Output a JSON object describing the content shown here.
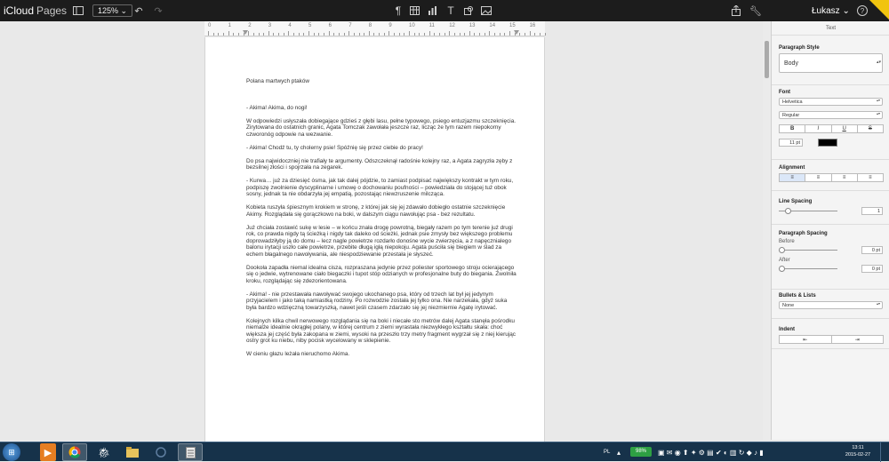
{
  "app": {
    "brand": "iCloud",
    "product": "Pages",
    "zoom": "125%",
    "user": "Łukasz ⌄"
  },
  "toolbar": {
    "left_icons": [
      "sidebar-icon",
      "undo-icon",
      "redo-icon"
    ],
    "center_icons": [
      "paragraph-icon",
      "table-icon",
      "chart-icon",
      "textbox-icon",
      "shape-icon",
      "image-icon"
    ],
    "right_icons": [
      "share-icon",
      "wrench-icon",
      "help-icon"
    ]
  },
  "ruler": {
    "labels": [
      "0",
      "1",
      "2",
      "3",
      "4",
      "5",
      "6",
      "7",
      "8",
      "9",
      "10",
      "11",
      "12",
      "13",
      "14",
      "15",
      "16"
    ]
  },
  "document": {
    "title": "Polana martwych ptaków",
    "paragraphs": [
      "- Akima! Akima, do nogi!",
      "W odpowiedzi usłyszała dobiegające gdzieś z głębi lasu, pełne typowego, psiego entuzjazmu szczeknięcia. Zirytowana do ostatnich granic, Agata Tomczak zawołała jeszcze raz, licząc że tym razem niepokorny czworonóg odpowie na wezwanie.",
      "- Akima! Chodź tu, ty cholerny psie! Spóźnię się przez ciebie do pracy!",
      "Do psa najwidoczniej nie trafiały te argumenty. Odszczeknął radośnie kolejny raz, a Agata zagryzła zęby z bezsilnej złości i spojrzała na zegarek.",
      "- Kurwa… już za dziesięć ósma, jak tak dalej pójdzie, to zamiast podpisać największy kontrakt w tym roku, podpiszę zwolnienie dyscyplinarne i umowę o dochowaniu poufności – powiedziała do stojącej tuż obok sosny, jednak ta nie obdarzyła jej empatią, pozostając niewzruszenie milcząca.",
      "Kobieta ruszyła śpiesznym krokiem w stronę, z której jak się jej zdawało dobiegło ostatnie szczeknięcie Akimy. Rozglądała się gorączkowo na boki, w dalszym ciągu nawołując psa - bez rezultatu.",
      "Już chciała zostawić sukę w lesie – w końcu znała drogę powrotną, biegały razem po tym terenie już drugi rok, co prawda nigdy tą ścieżką i nigdy tak daleko od ścieżki, jednak psie zmysły bez większego problemu doprowadziłyby ją do domu – lecz nagle powietrze rozdarło donośne wycie zwierzęcia, a z napęcznialego balonu irytacji uszło całe powietrze, przebite długą igłą niepokoju. Agata puściła się biegiem w ślad za echem błagalnego nawoływania, ale niespodziewanie przestała je słyszeć.",
      "Dookoła zapadła niemal idealna cisza, rozpraszana jedynie przez poliester sportowego stroju ocierającego się o jedwie, wytrenowane ciało biegaczki i tupot stóp odzianych w profesjonalne buty do biegania. Zwolniła kroku, rozglądając się zdezorientowana.",
      "- Akima! - nie przestawała nawoływać swojego ukochanego psa, który od trzech lat był jej jedynym przyjacielem i jako taką namiastką rodziny. Po rozwodzie została jej tylko ona. Nie narzekała, gdyż suka była bardzo wdzięczną towarzyszką, nawet jeśli czasem zdarzało się jej niezmiernie Agatę irytować.",
      "Kolejnych kilka chwil nerwowego rozglądania się na boki i niecałe sto metrów dalej Agata stanęła pośrodku niemalże idealnie okrągłej polany, w której centrum z ziemi wyrastała niezwykłego kształtu skała: choć większa jej część była zakopana w ziemi, wysoki na przeszło trzy metry fragment wygrzał się z niej kierując ostry grot ku niebu, niby pocisk wycelowany w sklepienie.",
      "W cieniu głazu leżała nieruchomo Akima."
    ]
  },
  "panel": {
    "header": "Text",
    "paragraph_style": {
      "label": "Paragraph Style",
      "value": "Body"
    },
    "font": {
      "label": "Font",
      "family": "Helvetica",
      "style": "Regular",
      "bold": "B",
      "italic": "I",
      "underline": "U",
      "strike": "S",
      "size": "11 pt",
      "color": "#000000"
    },
    "alignment": {
      "label": "Alignment",
      "selected": "left"
    },
    "line_spacing": {
      "label": "Line Spacing",
      "value": "1"
    },
    "paragraph_spacing": {
      "label": "Paragraph Spacing",
      "before_label": "Before",
      "before_value": "0 pt",
      "after_label": "After",
      "after_value": "0 pt"
    },
    "bullets": {
      "label": "Bullets & Lists",
      "value": "None"
    },
    "indent": {
      "label": "Indent"
    }
  },
  "taskbar": {
    "apps": [
      "media-player-icon",
      "chrome-icon",
      "app-icon",
      "explorer-icon",
      "app2-icon",
      "pages-icon"
    ],
    "lang": "PL",
    "battery": "98%",
    "time": "13:11",
    "date": "2015-02-27"
  },
  "colors": {
    "topbar": "#1c1c1c",
    "taskbar": "#16324a",
    "beta": "#f1c40f",
    "active_align": "#dbe7f8"
  }
}
